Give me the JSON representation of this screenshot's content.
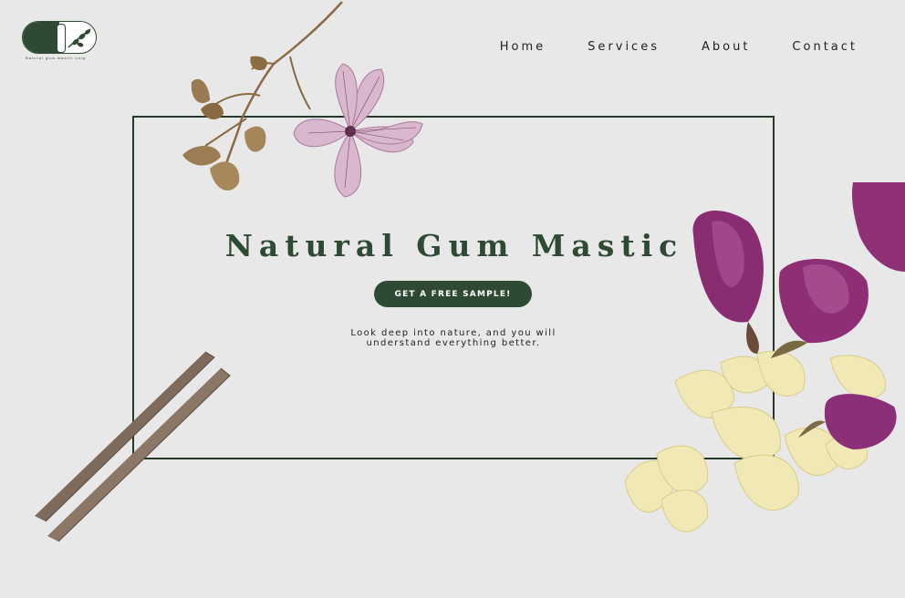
{
  "logo": {
    "tagline": "Natural gum mastic corp"
  },
  "nav": {
    "items": [
      "Home",
      "Services",
      "About",
      "Contact"
    ]
  },
  "hero": {
    "title": "Natural Gum Mastic",
    "cta_label": "GET A FREE SAMPLE!",
    "quote_line1": "Look deep into nature, and you will",
    "quote_line2": "understand everything better."
  },
  "colors": {
    "background": "#e8e8e8",
    "brand": "#2f4a33",
    "frame": "#243a27"
  },
  "images": [
    "dried-stem-illustration",
    "pink-flower-illustration",
    "licorice-sticks-illustration",
    "roses-and-mastic-resin-illustration"
  ]
}
